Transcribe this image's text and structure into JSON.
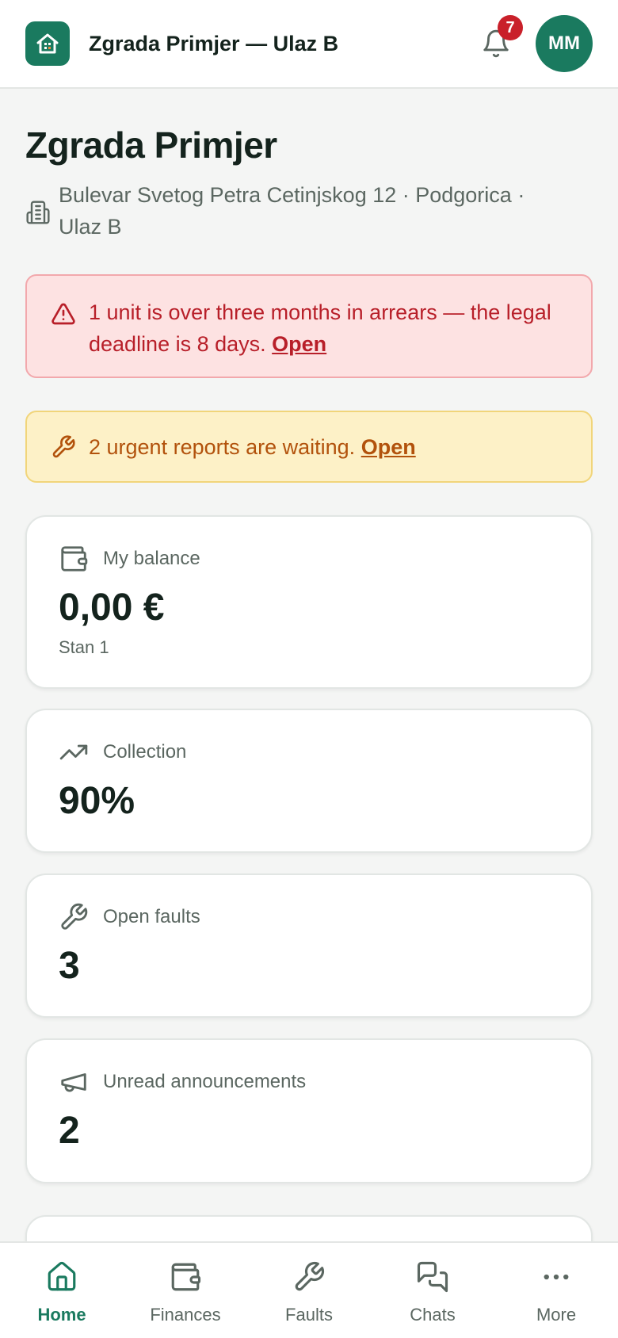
{
  "header": {
    "title": "Zgrada Primjer — Ulaz B",
    "notification_count": "7",
    "avatar_initials": "MM"
  },
  "building": {
    "name": "Zgrada Primjer",
    "address": "Bulevar Svetog Petra Cetinjskog 12 · Podgorica · Ulaz B"
  },
  "alerts": {
    "arrears": {
      "text": "1 unit is over three months in arrears — the legal deadline is 8 days.",
      "link": "Open"
    },
    "urgent": {
      "text": "2 urgent reports are waiting.",
      "link": "Open"
    }
  },
  "cards": {
    "balance": {
      "label": "My balance",
      "value": "0,00 €",
      "sub": "Stan 1"
    },
    "collection": {
      "label": "Collection",
      "value": "90%"
    },
    "faults": {
      "label": "Open faults",
      "value": "3"
    },
    "announcements": {
      "label": "Unread announcements",
      "value": "2"
    }
  },
  "nav": {
    "home": "Home",
    "finances": "Finances",
    "faults": "Faults",
    "chats": "Chats",
    "more": "More"
  },
  "colors": {
    "brand": "#1a7a5f",
    "danger": "#c9202a",
    "warning_text": "#b2520c"
  }
}
